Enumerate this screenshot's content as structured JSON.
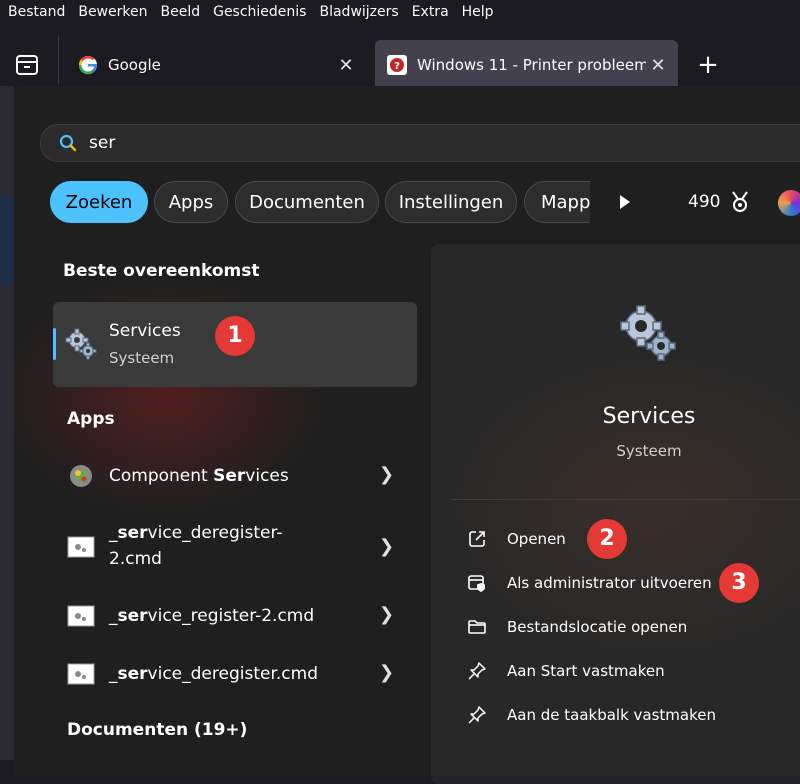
{
  "menu": [
    "Bestand",
    "Bewerken",
    "Beeld",
    "Geschiedenis",
    "Bladwijzers",
    "Extra",
    "Help"
  ],
  "tabs": [
    {
      "title": "Google",
      "close": "✕"
    },
    {
      "title": "Windows 11 - Printer probleem |",
      "close": "✕"
    }
  ],
  "new_tab": "+",
  "search": {
    "value": "ser"
  },
  "filters": [
    "Zoeken",
    "Apps",
    "Documenten",
    "Instellingen",
    "Mapp"
  ],
  "rewards": {
    "points": "490"
  },
  "best_match": {
    "heading": "Beste overeenkomst",
    "name": "Services",
    "type": "Systeem",
    "badge": "1"
  },
  "apps": {
    "heading": "Apps",
    "items": [
      {
        "pre": "Component ",
        "bold": "Ser",
        "post": "vices"
      },
      {
        "pre": "_",
        "bold": "ser",
        "post": "vice_deregister-",
        "line2": "2.cmd"
      },
      {
        "pre": "_",
        "bold": "ser",
        "post": "vice_register-2.cmd"
      },
      {
        "pre": "_",
        "bold": "ser",
        "post": "vice_deregister.cmd"
      }
    ]
  },
  "documents": {
    "heading": "Documenten (19+)"
  },
  "detail": {
    "title": "Services",
    "subtitle": "Systeem",
    "actions": [
      {
        "label": "Openen",
        "icon": "open-external-icon"
      },
      {
        "label": "Als administrator uitvoeren",
        "icon": "shield-admin-icon"
      },
      {
        "label": "Bestandslocatie openen",
        "icon": "folder-icon"
      },
      {
        "label": "Aan Start vastmaken",
        "icon": "pin-icon"
      },
      {
        "label": "Aan de taakbalk vastmaken",
        "icon": "pin-icon"
      }
    ],
    "badges": [
      "2",
      "3"
    ]
  },
  "colors": {
    "accent": "#4cc2ff",
    "badge": "#e53935"
  }
}
